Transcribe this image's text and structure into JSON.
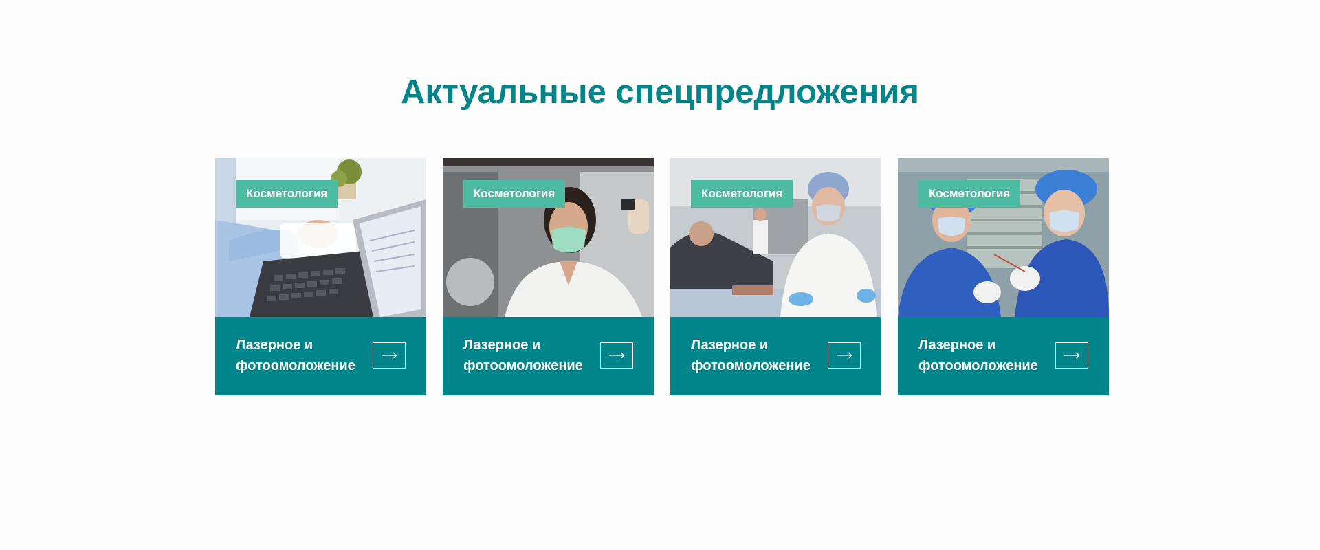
{
  "section": {
    "title": "Актуальные спецпредложения"
  },
  "cards": [
    {
      "badge": "Косметология",
      "caption": "Лазерное и фотоомоложение",
      "image": "office-laptop-photo",
      "arrow_icon": "arrow-right-icon"
    },
    {
      "badge": "Косметология",
      "caption": "Лазерное и фотоомоложение",
      "image": "lab-scientist-photo",
      "arrow_icon": "arrow-right-icon"
    },
    {
      "badge": "Косметология",
      "caption": "Лазерное и фотоомоложение",
      "image": "lab-technicians-photo",
      "arrow_icon": "arrow-right-icon"
    },
    {
      "badge": "Косметология",
      "caption": "Лазерное и фотоомоложение",
      "image": "clinic-procedure-photo",
      "arrow_icon": "arrow-right-icon"
    }
  ],
  "colors": {
    "accent": "#00858a",
    "badge": "#4dbba2",
    "background": "#fdfdfd"
  }
}
